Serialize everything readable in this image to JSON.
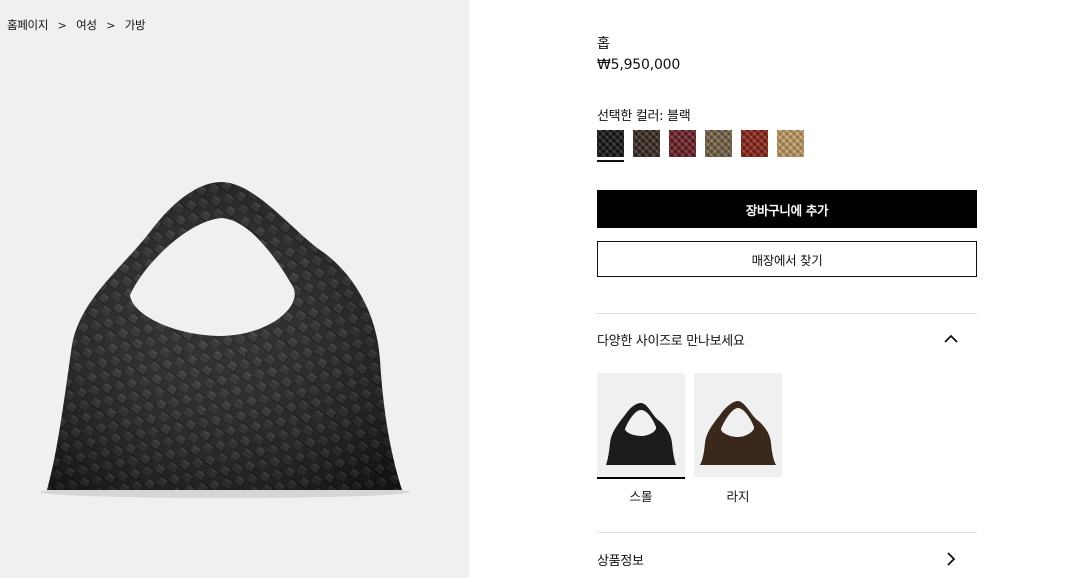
{
  "breadcrumb": {
    "items": [
      "홈페이지",
      "여성",
      "가방"
    ],
    "separator": ">"
  },
  "product": {
    "name": "홉",
    "price": "₩5,950,000"
  },
  "color": {
    "label": "선택한 컬러: 블랙",
    "swatches": [
      {
        "name": "black",
        "hex": "#151515",
        "selected": true
      },
      {
        "name": "dark-brown",
        "hex": "#3a2a22",
        "selected": false
      },
      {
        "name": "burgundy",
        "hex": "#6e2027",
        "selected": false
      },
      {
        "name": "olive-brown",
        "hex": "#7a6447",
        "selected": false
      },
      {
        "name": "red-brown",
        "hex": "#8f2417",
        "selected": false
      },
      {
        "name": "tan",
        "hex": "#c8a067",
        "selected": false
      }
    ]
  },
  "actions": {
    "add_to_cart": "장바구니에 추가",
    "find_in_store": "매장에서 찾기"
  },
  "sizes_section": {
    "title": "다양한 사이즈로 만나보세요",
    "expanded": true,
    "options": [
      {
        "label": "스몰",
        "selected": true,
        "color": "#1a1a1a"
      },
      {
        "label": "라지",
        "selected": false,
        "color": "#3b281d"
      }
    ]
  },
  "product_info": {
    "title": "상품정보"
  },
  "icons": {
    "breadcrumb_separator": "chevron-right-icon",
    "sizes_toggle": "chevron-up-icon",
    "product_info": "chevron-right-icon"
  }
}
